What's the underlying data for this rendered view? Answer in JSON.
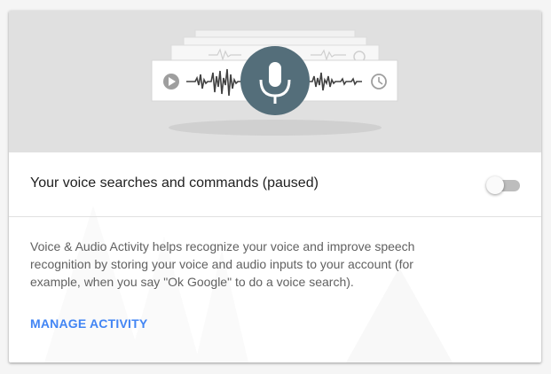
{
  "hero": {
    "icons": [
      "play-icon",
      "microphone-icon",
      "clock-icon"
    ],
    "colors": {
      "background": "#e0e0e0",
      "mic_circle": "#546e7a",
      "waveform": "#424242"
    }
  },
  "voice_setting": {
    "label": "Your voice searches and commands (paused)",
    "toggle_on": false
  },
  "description": "Voice & Audio Activity helps recognize your voice and improve speech recognition by storing your voice and audio inputs to your account (for example, when you say \"Ok Google\" to do a voice search).",
  "manage_link": {
    "label": "MANAGE ACTIVITY",
    "color": "#4285f4"
  }
}
